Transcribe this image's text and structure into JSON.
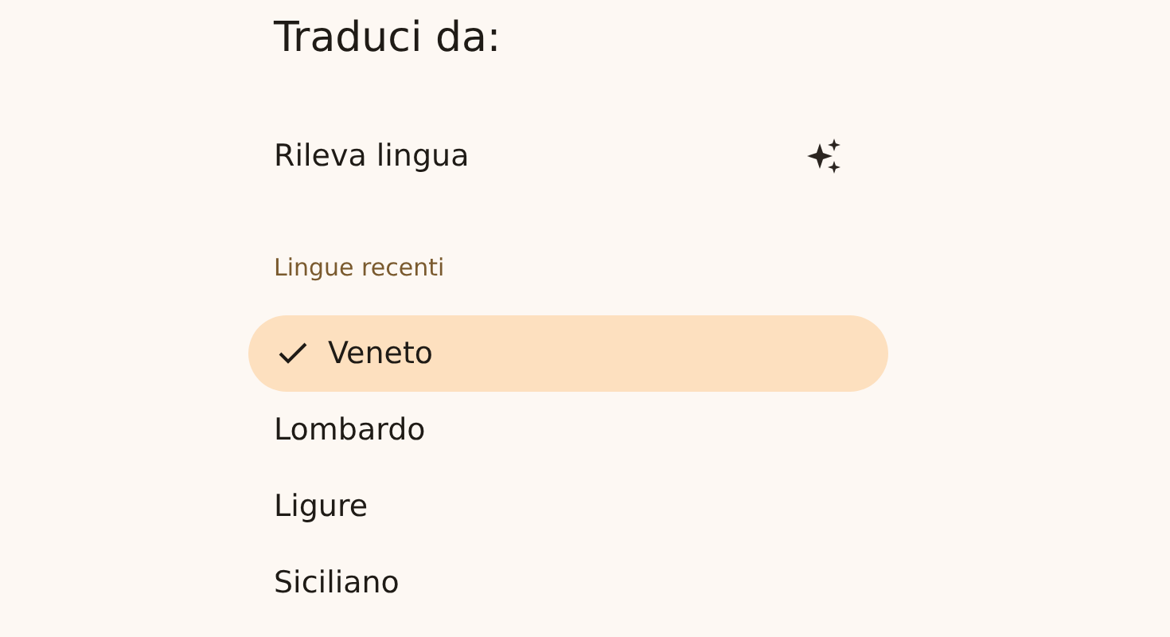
{
  "title": "Traduci da:",
  "detect": {
    "label": "Rileva lingua"
  },
  "section_label": "Lingue recenti",
  "languages": [
    {
      "label": "Veneto",
      "selected": true
    },
    {
      "label": "Lombardo",
      "selected": false
    },
    {
      "label": "Ligure",
      "selected": false
    },
    {
      "label": "Siciliano",
      "selected": false
    }
  ]
}
